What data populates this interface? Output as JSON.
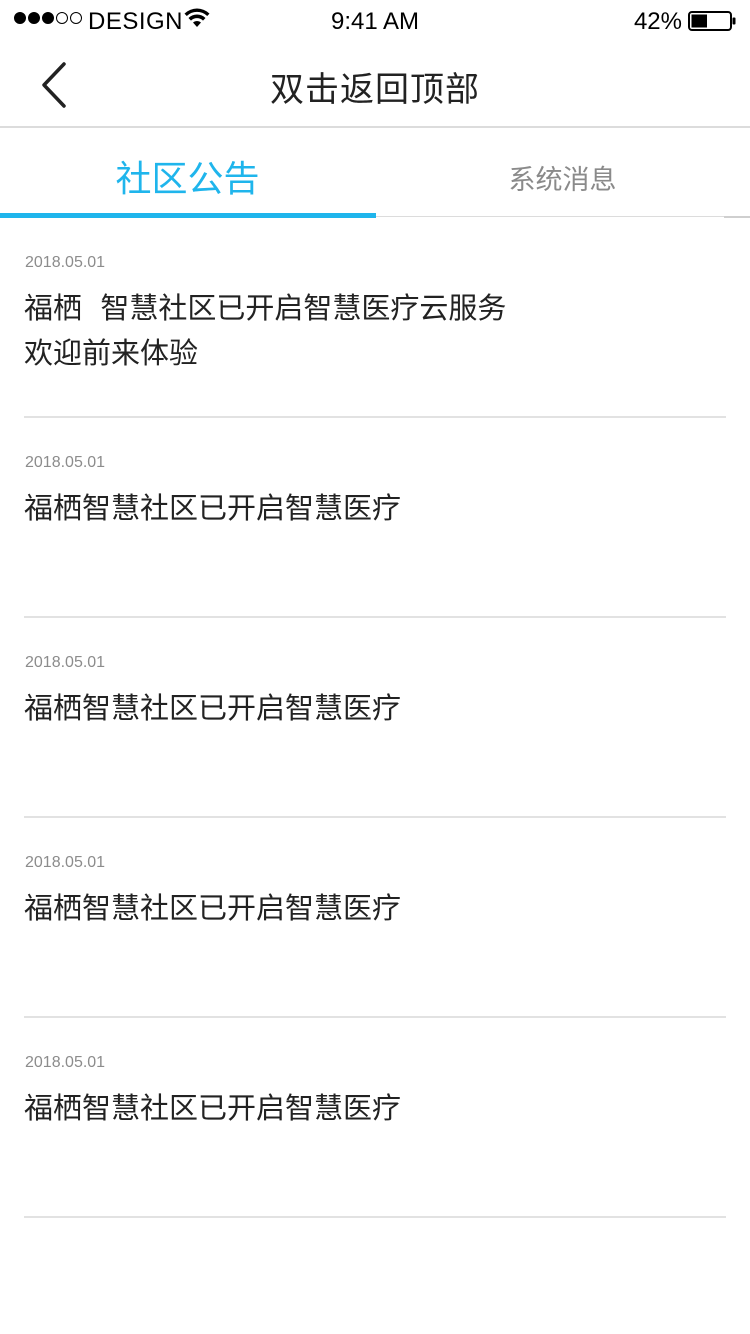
{
  "status_bar": {
    "carrier": "DESIGN",
    "time": "9:41 AM",
    "battery_percent": "42%",
    "battery_level": 0.42,
    "signal_bars_filled": 3,
    "signal_bars_total": 5
  },
  "nav": {
    "back_icon": "chevron-left-icon",
    "title": "双击返回顶部"
  },
  "tabs": [
    {
      "label": "社区公告",
      "active": true
    },
    {
      "label": "系统消息",
      "active": false
    }
  ],
  "colors": {
    "accent": "#1fb5ec",
    "divider": "#e2e2e2",
    "inactive_tab": "#8a8a8a",
    "date_text": "#8c8c8c"
  },
  "notices": [
    {
      "date": "2018.05.01",
      "text": "福栖  智慧社区已开启智慧医疗云服务 欢迎前来体验"
    },
    {
      "date": "2018.05.01",
      "text": "福栖智慧社区已开启智慧医疗"
    },
    {
      "date": "2018.05.01",
      "text": "福栖智慧社区已开启智慧医疗"
    },
    {
      "date": "2018.05.01",
      "text": "福栖智慧社区已开启智慧医疗"
    },
    {
      "date": "2018.05.01",
      "text": "福栖智慧社区已开启智慧医疗"
    }
  ]
}
